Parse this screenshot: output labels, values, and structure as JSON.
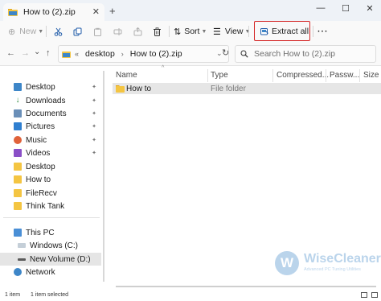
{
  "window": {
    "tab_title": "How to (2).zip",
    "tab_close_glyph": "✕",
    "new_tab_glyph": "+",
    "minimize_glyph": "—",
    "maximize_glyph": "☐",
    "close_glyph": "✕"
  },
  "toolbar": {
    "new_label": "New",
    "sort_label": "Sort",
    "view_label": "View",
    "extract_all_label": "Extract all",
    "more_label": "···",
    "cut_icon": "cut-icon",
    "copy_icon": "copy-icon",
    "rename_icon": "rename-icon",
    "share_icon": "share-icon",
    "delete_icon": "delete-icon",
    "highlight_color": "#d42424"
  },
  "address": {
    "back_glyph": "←",
    "forward_glyph": "→",
    "recent_glyph": "⌄",
    "up_glyph": "↑",
    "overflow_glyph": "«",
    "path": [
      "desktop",
      "How to (2).zip"
    ],
    "path_separator": "›",
    "dropdown_glyph": "⌄",
    "refresh_glyph": "↻",
    "search_placeholder": "Search How to (2).zip",
    "search_glyph": "⚲"
  },
  "navigation": {
    "quick_access": [
      {
        "label": "Desktop",
        "icon": "desktop-folder-icon",
        "pinned": true
      },
      {
        "label": "Downloads",
        "icon": "downloads-icon",
        "pinned": true
      },
      {
        "label": "Documents",
        "icon": "documents-icon",
        "pinned": true
      },
      {
        "label": "Pictures",
        "icon": "pictures-icon",
        "pinned": true
      },
      {
        "label": "Music",
        "icon": "music-icon",
        "pinned": true
      },
      {
        "label": "Videos",
        "icon": "videos-icon",
        "pinned": true
      },
      {
        "label": "Desktop",
        "icon": "folder-icon",
        "pinned": false
      },
      {
        "label": "How to",
        "icon": "folder-icon",
        "pinned": false
      },
      {
        "label": "FileRecv",
        "icon": "folder-icon",
        "pinned": false
      },
      {
        "label": "Think Tank",
        "icon": "folder-icon",
        "pinned": false
      }
    ],
    "pin_glyph": "📌",
    "this_pc": "This PC",
    "drive_c": "Windows (C:)",
    "drive_d": "New Volume (D:)",
    "network": "Network",
    "expand_glyph": "›"
  },
  "content": {
    "columns": [
      "Name",
      "Type",
      "Compressed...",
      "Passw...",
      "Size"
    ],
    "sort_caret": "^",
    "rows": [
      {
        "name": "How to",
        "type": "File folder"
      }
    ]
  },
  "status": {
    "item_count": "1 item",
    "selected": "1 item selected"
  },
  "watermark": {
    "logo_letter": "W",
    "name": "WiseCleaner",
    "tagline": "Advanced PC Tuning Utilities"
  },
  "colors": {
    "folder": "#f4c542",
    "selection": "#e6e6e6",
    "accent": "#0067c0"
  }
}
